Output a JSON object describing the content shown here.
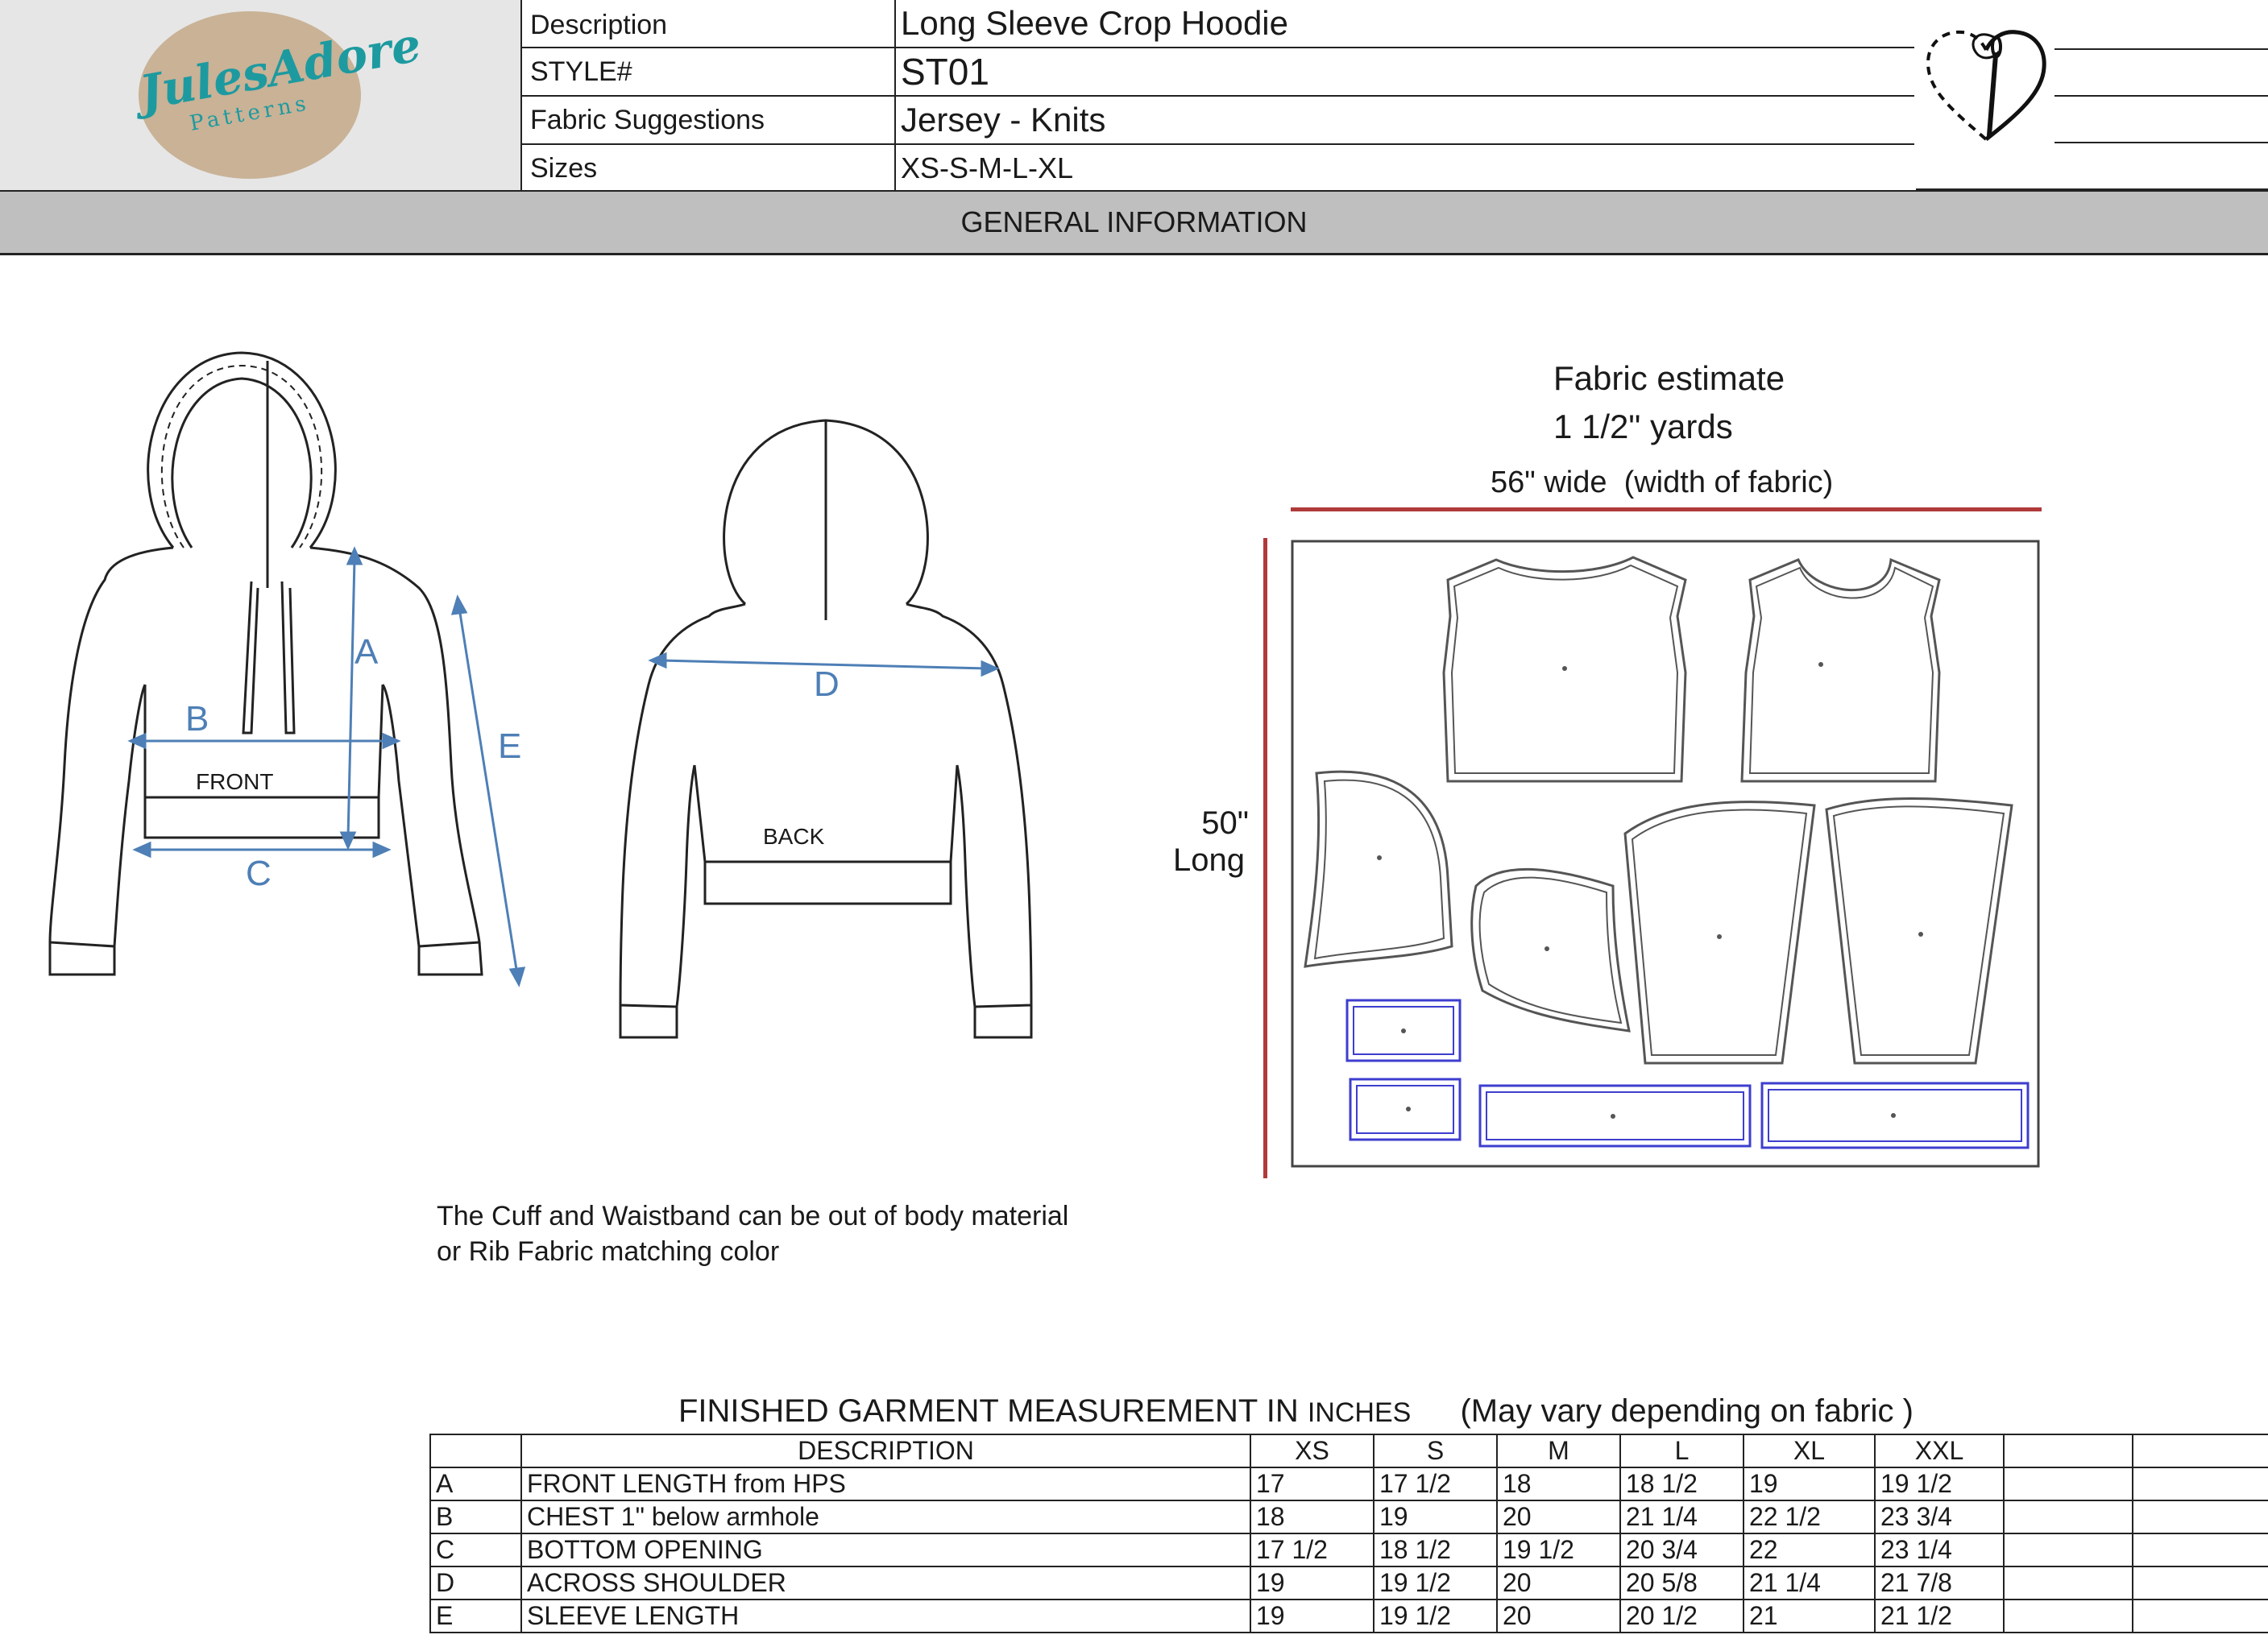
{
  "logo": {
    "brand": "JulesAdore",
    "sub": "Patterns"
  },
  "header": {
    "rows": [
      {
        "label": "Description",
        "value": "Long Sleeve Crop Hoodie"
      },
      {
        "label": "STYLE#",
        "value": "ST01"
      },
      {
        "label": "Fabric Suggestions",
        "value": "Jersey - Knits"
      },
      {
        "label": "Sizes",
        "value": "XS-S-M-L-XL"
      }
    ],
    "icon": "heart-needle-icon"
  },
  "section_title": "GENERAL INFORMATION",
  "sketch": {
    "front_label": "FRONT",
    "back_label": "BACK",
    "callouts": {
      "a": "A",
      "b": "B",
      "c": "C",
      "d": "D",
      "e": "E"
    },
    "callout_color": "#4e7fb6"
  },
  "note": {
    "line1": "The Cuff and Waistband can be out of body material",
    "line2": "or Rib Fabric matching color"
  },
  "fabric": {
    "estimate_title": "Fabric estimate",
    "estimate_value": "1 1/2\" yards",
    "width_label": "56\" wide  (width of fabric)",
    "length_line1": "50\"",
    "length_line2": "Long",
    "dimension_color": "#b03a3a"
  },
  "measurements": {
    "title": "FINISHED GARMENT MEASUREMENT IN",
    "unit": "INCHES",
    "note": "(May vary depending on fabric )",
    "header": [
      "",
      "DESCRIPTION",
      "XS",
      "S",
      "M",
      "L",
      "XL",
      "XXL",
      "",
      ""
    ],
    "rows": [
      [
        "A",
        "FRONT LENGTH from HPS",
        "17",
        "17 1/2",
        "18",
        "18 1/2",
        "19",
        "19 1/2",
        "",
        ""
      ],
      [
        "B",
        "CHEST 1\" below armhole",
        "18",
        "19",
        "20",
        "21 1/4",
        "22 1/2",
        "23 3/4",
        "",
        ""
      ],
      [
        "C",
        "BOTTOM OPENING",
        "17 1/2",
        "18 1/2",
        "19 1/2",
        "20 3/4",
        "22",
        "23 1/4",
        "",
        ""
      ],
      [
        "D",
        "ACROSS SHOULDER",
        "19",
        "19 1/2",
        "20",
        "20 5/8",
        "21 1/4",
        "21 7/8",
        "",
        ""
      ],
      [
        "E",
        "SLEEVE LENGTH",
        "19",
        "19 1/2",
        "20",
        "20 1/2",
        "21",
        "21 1/2",
        "",
        ""
      ]
    ]
  }
}
